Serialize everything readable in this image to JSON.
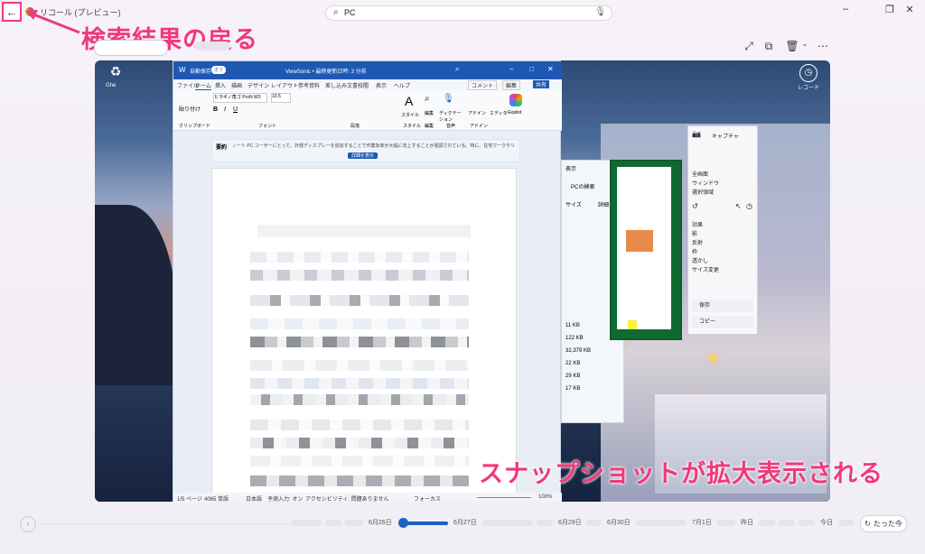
{
  "app": {
    "title": "リコール (プレビュー)"
  },
  "search": {
    "value": "PC"
  },
  "annotations": {
    "back_label": "検索結果の戻る",
    "snapshot_label": "スナップショットが拡大表示される"
  },
  "snapshot": {
    "desktop": {
      "recycle_label": "Ghe",
      "clock_label": "レコード"
    },
    "word": {
      "autosave": "自動保存",
      "autosave_state": "オフ",
      "doc_title": "ViewSonic • 最終更新日時: 3 分前",
      "menu": [
        "ファイル",
        "ホーム",
        "挿入",
        "描画",
        "デザイン",
        "レイアウト",
        "参考資料",
        "差し込み文書",
        "校閲",
        "表示",
        "ヘルプ"
      ],
      "comment": "コメント",
      "edit": "編集",
      "share": "共有",
      "font": "ヒラギノ角ゴ ProN W3",
      "font_size": "10.5",
      "group_labels": [
        "クリップボード",
        "フォント",
        "段落",
        "スタイル",
        "編集",
        "音声",
        "アドイン"
      ],
      "paste": "貼り付け",
      "styles": "スタイル",
      "editing": "編集",
      "dictate": "ディクテーション",
      "addins": "アドイン",
      "editor": "エディター",
      "copilot": "Copilot",
      "summary_title": "要約",
      "summary_text": "ノート PC ユーザーにとって、外部ディスプレーを追加することで作業効率が大幅に向上することが強調されている。特に、在宅ワークやリモートワークが増える中で、画面の拡張によるメリットについての提案がなされている。",
      "show_more": "詳細を表示",
      "status": [
        "1/5 ページ",
        "4065 単語",
        "日本語",
        "予測入力: オン",
        "アクセシビリティ: 問題ありません",
        "フォーカス",
        "100%"
      ]
    },
    "explorer": {
      "title": "PCの検索",
      "view": "表示",
      "sizes": [
        "11 KB",
        "122 KB",
        "32,379 KB",
        "22 KB",
        "29 KB",
        "17 KB"
      ],
      "col_size": "サイズ",
      "detail": "詳細"
    },
    "snip": {
      "capture": "キャプチャ",
      "modes": [
        "全画面",
        "ウィンドウ",
        "選択領域"
      ],
      "effects_title": "効果",
      "effects": [
        "影",
        "反射",
        "枠",
        "透かし",
        "サイズ変更"
      ],
      "save": "保存",
      "copy": "コピー"
    }
  },
  "timeline": {
    "dates": [
      "6月26日",
      "6月27日",
      "6月29日",
      "6月30日",
      "7月1日",
      "昨日",
      "今日"
    ],
    "now": "たった今"
  }
}
